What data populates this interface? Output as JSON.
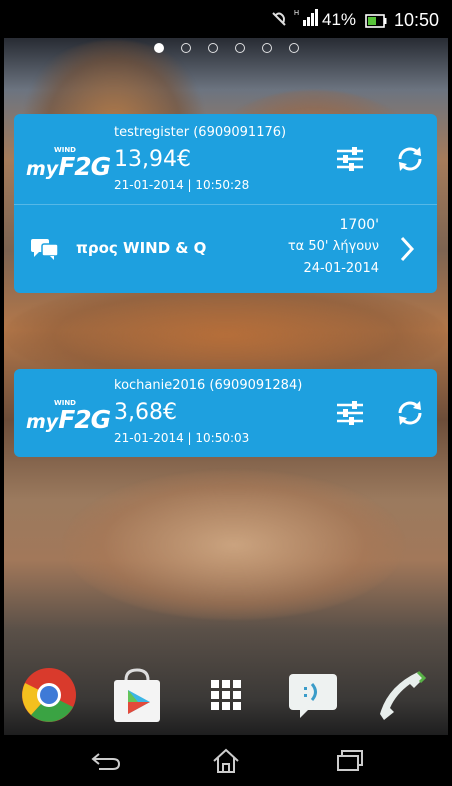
{
  "status_bar": {
    "battery": "41%",
    "time": "10:50"
  },
  "home_pages": {
    "count": 6,
    "active_index": 0
  },
  "widgets": [
    {
      "logo_brand": "WIND",
      "logo_text": "myF2G",
      "account": "testregister (6909091176)",
      "balance": "13,94€",
      "timestamp": "21-01-2014 | 10:50:28",
      "offer": {
        "label": "προς WIND & Q",
        "minutes": "1700'",
        "remaining": "τα 50' λήγουν",
        "expiry": "24-01-2014"
      }
    },
    {
      "logo_brand": "WIND",
      "logo_text": "myF2G",
      "account": "kochanie2016 (6909091284)",
      "balance": "3,68€",
      "timestamp": "21-01-2014 | 10:50:03"
    }
  ],
  "dock": {
    "apps": [
      "chrome-icon",
      "play-store-icon",
      "app-drawer-icon",
      "messaging-icon",
      "phone-icon"
    ]
  },
  "colors": {
    "widget_bg": "#1ea0df"
  }
}
